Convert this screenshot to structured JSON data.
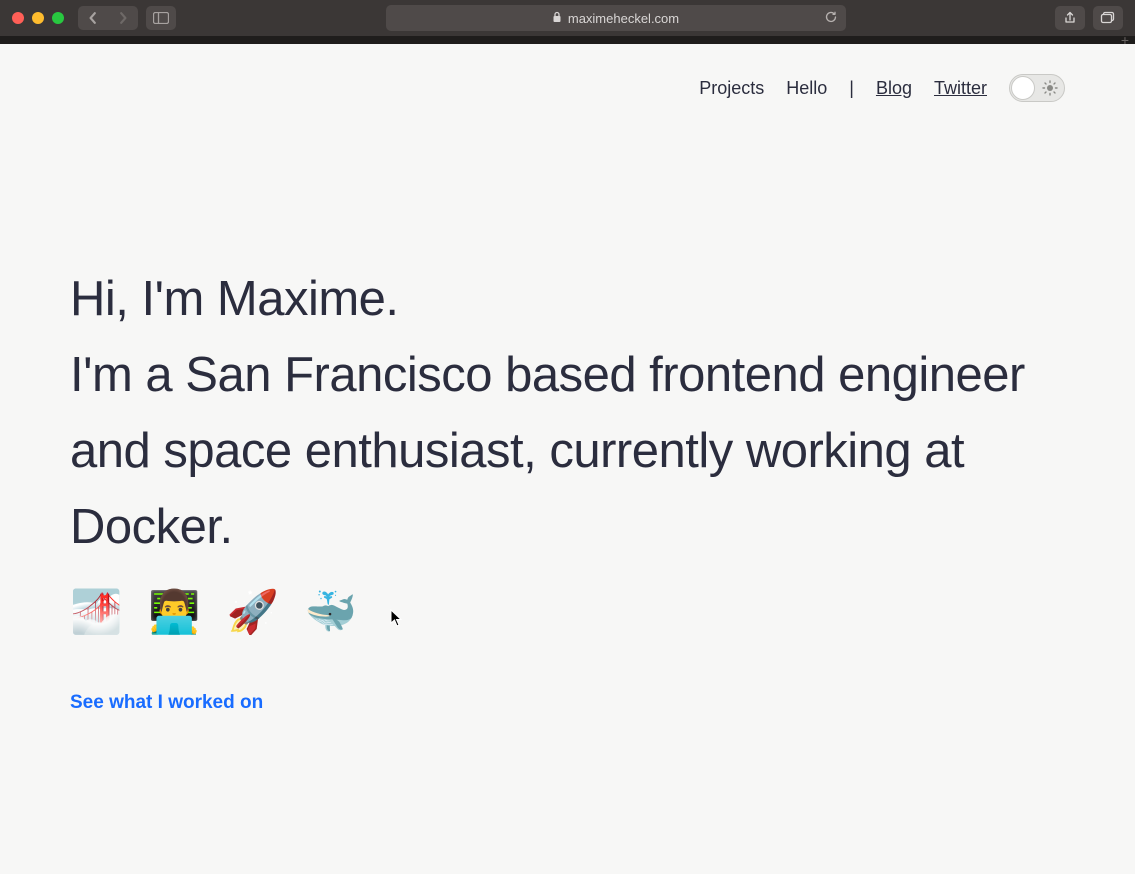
{
  "chrome": {
    "url_host": "maximeheckel.com"
  },
  "nav": {
    "projects": "Projects",
    "hello": "Hello",
    "separator": "|",
    "blog": "Blog",
    "twitter": "Twitter"
  },
  "hero": {
    "line1": "Hi, I'm Maxime.",
    "line2": "I'm a San Francisco based frontend engineer and space enthusiast, currently working at Docker."
  },
  "emojis": {
    "bridge": "🌁",
    "technologist": "👨‍💻",
    "rocket": "🚀",
    "whale": "🐳"
  },
  "cta": "See what I worked on"
}
